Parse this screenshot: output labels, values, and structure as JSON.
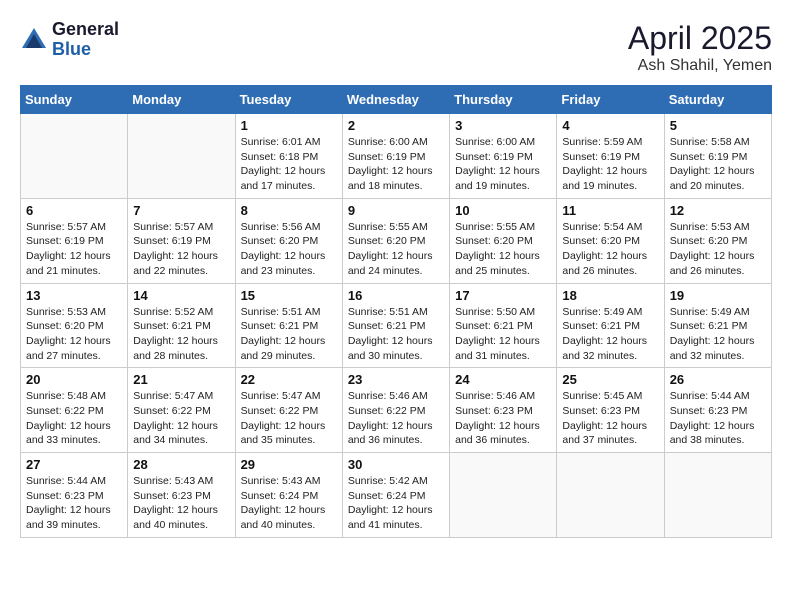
{
  "logo": {
    "general": "General",
    "blue": "Blue"
  },
  "title": "April 2025",
  "subtitle": "Ash Shahil, Yemen",
  "weekdays": [
    "Sunday",
    "Monday",
    "Tuesday",
    "Wednesday",
    "Thursday",
    "Friday",
    "Saturday"
  ],
  "weeks": [
    [
      {
        "day": "",
        "info": ""
      },
      {
        "day": "",
        "info": ""
      },
      {
        "day": "1",
        "info": "Sunrise: 6:01 AM\nSunset: 6:18 PM\nDaylight: 12 hours and 17 minutes."
      },
      {
        "day": "2",
        "info": "Sunrise: 6:00 AM\nSunset: 6:19 PM\nDaylight: 12 hours and 18 minutes."
      },
      {
        "day": "3",
        "info": "Sunrise: 6:00 AM\nSunset: 6:19 PM\nDaylight: 12 hours and 19 minutes."
      },
      {
        "day": "4",
        "info": "Sunrise: 5:59 AM\nSunset: 6:19 PM\nDaylight: 12 hours and 19 minutes."
      },
      {
        "day": "5",
        "info": "Sunrise: 5:58 AM\nSunset: 6:19 PM\nDaylight: 12 hours and 20 minutes."
      }
    ],
    [
      {
        "day": "6",
        "info": "Sunrise: 5:57 AM\nSunset: 6:19 PM\nDaylight: 12 hours and 21 minutes."
      },
      {
        "day": "7",
        "info": "Sunrise: 5:57 AM\nSunset: 6:19 PM\nDaylight: 12 hours and 22 minutes."
      },
      {
        "day": "8",
        "info": "Sunrise: 5:56 AM\nSunset: 6:20 PM\nDaylight: 12 hours and 23 minutes."
      },
      {
        "day": "9",
        "info": "Sunrise: 5:55 AM\nSunset: 6:20 PM\nDaylight: 12 hours and 24 minutes."
      },
      {
        "day": "10",
        "info": "Sunrise: 5:55 AM\nSunset: 6:20 PM\nDaylight: 12 hours and 25 minutes."
      },
      {
        "day": "11",
        "info": "Sunrise: 5:54 AM\nSunset: 6:20 PM\nDaylight: 12 hours and 26 minutes."
      },
      {
        "day": "12",
        "info": "Sunrise: 5:53 AM\nSunset: 6:20 PM\nDaylight: 12 hours and 26 minutes."
      }
    ],
    [
      {
        "day": "13",
        "info": "Sunrise: 5:53 AM\nSunset: 6:20 PM\nDaylight: 12 hours and 27 minutes."
      },
      {
        "day": "14",
        "info": "Sunrise: 5:52 AM\nSunset: 6:21 PM\nDaylight: 12 hours and 28 minutes."
      },
      {
        "day": "15",
        "info": "Sunrise: 5:51 AM\nSunset: 6:21 PM\nDaylight: 12 hours and 29 minutes."
      },
      {
        "day": "16",
        "info": "Sunrise: 5:51 AM\nSunset: 6:21 PM\nDaylight: 12 hours and 30 minutes."
      },
      {
        "day": "17",
        "info": "Sunrise: 5:50 AM\nSunset: 6:21 PM\nDaylight: 12 hours and 31 minutes."
      },
      {
        "day": "18",
        "info": "Sunrise: 5:49 AM\nSunset: 6:21 PM\nDaylight: 12 hours and 32 minutes."
      },
      {
        "day": "19",
        "info": "Sunrise: 5:49 AM\nSunset: 6:21 PM\nDaylight: 12 hours and 32 minutes."
      }
    ],
    [
      {
        "day": "20",
        "info": "Sunrise: 5:48 AM\nSunset: 6:22 PM\nDaylight: 12 hours and 33 minutes."
      },
      {
        "day": "21",
        "info": "Sunrise: 5:47 AM\nSunset: 6:22 PM\nDaylight: 12 hours and 34 minutes."
      },
      {
        "day": "22",
        "info": "Sunrise: 5:47 AM\nSunset: 6:22 PM\nDaylight: 12 hours and 35 minutes."
      },
      {
        "day": "23",
        "info": "Sunrise: 5:46 AM\nSunset: 6:22 PM\nDaylight: 12 hours and 36 minutes."
      },
      {
        "day": "24",
        "info": "Sunrise: 5:46 AM\nSunset: 6:23 PM\nDaylight: 12 hours and 36 minutes."
      },
      {
        "day": "25",
        "info": "Sunrise: 5:45 AM\nSunset: 6:23 PM\nDaylight: 12 hours and 37 minutes."
      },
      {
        "day": "26",
        "info": "Sunrise: 5:44 AM\nSunset: 6:23 PM\nDaylight: 12 hours and 38 minutes."
      }
    ],
    [
      {
        "day": "27",
        "info": "Sunrise: 5:44 AM\nSunset: 6:23 PM\nDaylight: 12 hours and 39 minutes."
      },
      {
        "day": "28",
        "info": "Sunrise: 5:43 AM\nSunset: 6:23 PM\nDaylight: 12 hours and 40 minutes."
      },
      {
        "day": "29",
        "info": "Sunrise: 5:43 AM\nSunset: 6:24 PM\nDaylight: 12 hours and 40 minutes."
      },
      {
        "day": "30",
        "info": "Sunrise: 5:42 AM\nSunset: 6:24 PM\nDaylight: 12 hours and 41 minutes."
      },
      {
        "day": "",
        "info": ""
      },
      {
        "day": "",
        "info": ""
      },
      {
        "day": "",
        "info": ""
      }
    ]
  ]
}
